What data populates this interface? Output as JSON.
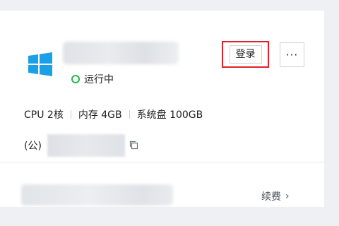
{
  "instance": {
    "status": "运行中",
    "status_color": "#1fb84a",
    "os_icon": "windows-logo-icon"
  },
  "actions": {
    "login_label": "登录",
    "more_label": "···"
  },
  "specs": {
    "cpu": "CPU 2核",
    "memory": "内存 4GB",
    "disk": "系统盘 100GB"
  },
  "ip": {
    "type_label": "(公)"
  },
  "footer": {
    "renew_label": "续费",
    "renew_chevron": "›"
  },
  "colors": {
    "highlight_border": "#e0202b",
    "windows_blue": "#1aa0e8"
  }
}
